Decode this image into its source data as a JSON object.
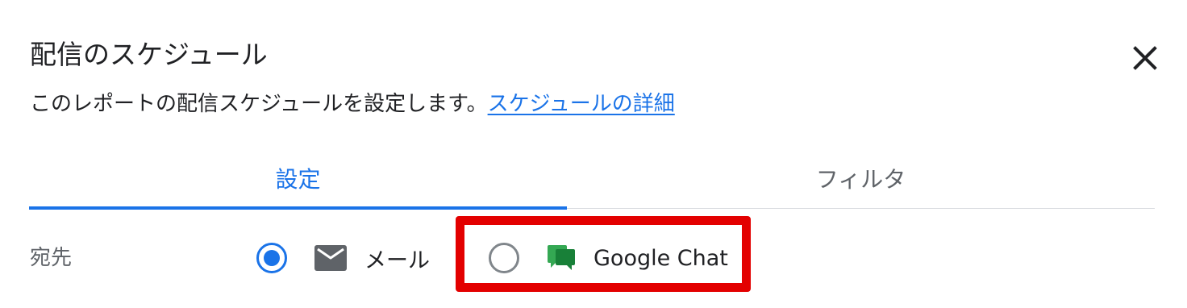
{
  "dialog": {
    "title": "配信のスケジュール",
    "subtitle": "このレポートの配信スケジュールを設定します。",
    "link": "スケジュールの詳細"
  },
  "tabs": [
    {
      "label": "設定",
      "active": true
    },
    {
      "label": "フィルタ",
      "active": false
    }
  ],
  "destination": {
    "label": "宛先",
    "options": [
      {
        "label": "メール",
        "icon": "mail-icon",
        "selected": true
      },
      {
        "label": "Google Chat",
        "icon": "google-chat-icon",
        "selected": false
      }
    ]
  },
  "colors": {
    "accent": "#1a73e8",
    "highlight": "#e30000",
    "chat_green_dark": "#188038",
    "chat_green_light": "#34a853"
  }
}
